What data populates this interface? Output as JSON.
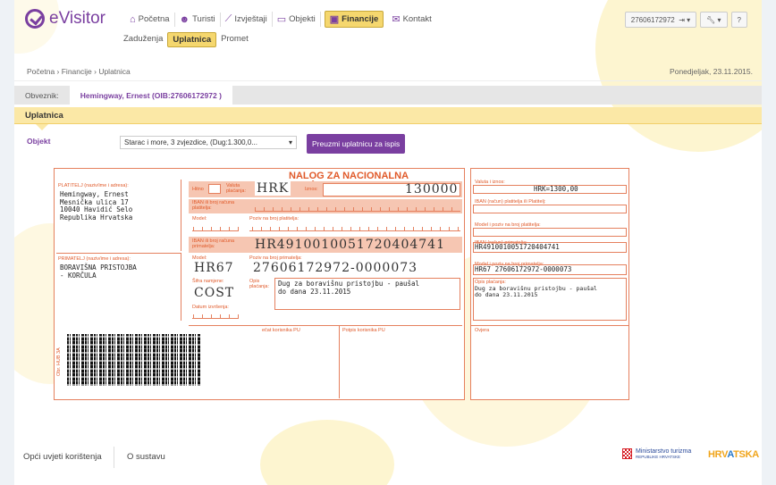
{
  "app": {
    "logo": "eVisitor"
  },
  "nav": [
    {
      "label": "Početna",
      "icon": "home-icon"
    },
    {
      "label": "Turisti",
      "icon": "users-icon"
    },
    {
      "label": "Izvještaji",
      "icon": "chart-icon"
    },
    {
      "label": "Objekti",
      "icon": "bed-icon"
    },
    {
      "label": "Financije",
      "icon": "money-icon",
      "active": true
    },
    {
      "label": "Kontakt",
      "icon": "mail-icon"
    }
  ],
  "subnav": [
    {
      "label": "Zaduženja"
    },
    {
      "label": "Uplatnica",
      "active": true
    },
    {
      "label": "Promet"
    }
  ],
  "top_right": {
    "user": "27606172972"
  },
  "breadcrumb": "Početna › Financije › Uplatnica",
  "date": "Ponedjeljak, 23.11.2015.",
  "obveznik": {
    "label": "Obveznik:",
    "value": "Hemingway, Ernest (OIB:27606172972 )"
  },
  "section_title": "Uplatnica",
  "objekt": {
    "label": "Objekt",
    "selected": "Starac i more, 3 zvjezdice, (Dug:1.300,0...",
    "button": "Preuzmi uplatnicu za ispis"
  },
  "slip": {
    "title": "NALOG ZA NACIONALNA PLAĆANJA",
    "payer_label": "PLATITELJ (naziv/ime i adresa):",
    "payer": "Hemingway, Ernest\nMesnička ulica 17\n10040 Havidić Selo\nRepublika Hrvatska",
    "hitno_label": "Hitno",
    "valuta_label": "Valuta plaćanja:",
    "currency": "HRK",
    "iznos_label": "Iznos:",
    "amount": "130000",
    "iban_payer_label": "IBAN ili broj računa platitelja:",
    "model_label": "Model:",
    "poziv_payer_label": "Poziv na broj platitelja:",
    "iban_rec_label": "IBAN ili broj računa primatelja:",
    "iban_rec": "HR4910010051720404741",
    "recipient_label": "PRIMATELJ (naziv/ime i adresa):",
    "recipient": "BORAVIŠNA PRISTOJBA\n- KORČULA",
    "model_rec_label": "Model:",
    "model_rec": "HR67",
    "poziv_rec_label": "Poziv na broj primatelja:",
    "poziv_rec": "27606172972-0000073",
    "sifra_label": "Šifra namjene:",
    "sifra": "COST",
    "opis_label": "Opis plaćanja:",
    "opis": "Dug za boravišnu pristojbu - paušal\ndo dana 23.11.2015",
    "datum_label": "Datum izvršenja:",
    "pecat_label": "ečat korisnika PU",
    "potpis_label": "Potpis korisnika PU",
    "side_code": "Obr. HUB 3A",
    "r_valuta_label": "Valuta i iznos:",
    "r_valuta": "HRK=1300,00",
    "r_iban_payer_label": "IBAN (račun) platitelja ili Platitelj:",
    "r_model_payer_label": "Model i poziv na broj platitelja:",
    "r_iban_label": "IBAN (račun) primatelja:",
    "r_iban": "HR4910010051720404741",
    "r_model_label": "Model i poziv na broj primatelja:",
    "r_model": "HR67 27606172972-0000073",
    "r_opis_label": "Opis plaćanja:",
    "r_opis": "Dug za boravišnu pristojbu - paušal\ndo dana 23.11.2015",
    "r_ovjera_label": "Ovjera"
  },
  "footer": {
    "terms": "Opći uvjeti korištenja",
    "about": "O sustavu",
    "ministry": "Ministarstvo turizma",
    "ministry_sub": "REPUBLIKE HRVATSKE",
    "hrv_a": "HRV",
    "hrv_b": "A",
    "hrv_c": "TSKA"
  }
}
